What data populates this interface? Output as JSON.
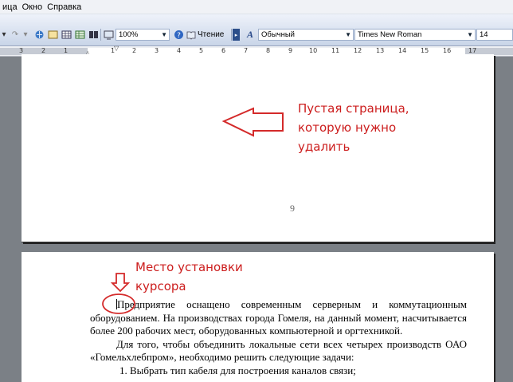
{
  "menubar": {
    "items": [
      "ица",
      "Окно",
      "Справка"
    ]
  },
  "toolbar": {
    "zoom": "100%",
    "read_mode": "Чтение",
    "style": "Обычный",
    "font": "Times New Roman",
    "font_size": "14"
  },
  "ruler": {
    "labels": [
      "3",
      "2",
      "1",
      "1",
      "2",
      "3",
      "4",
      "5",
      "6",
      "7",
      "8",
      "9",
      "10",
      "11",
      "12",
      "13",
      "14",
      "15",
      "16",
      "17"
    ]
  },
  "page1": {
    "page_number": "9"
  },
  "annotations": {
    "empty_page_line1": "Пустая страница,",
    "empty_page_line2": "которую нужно",
    "empty_page_line3": "удалить",
    "cursor_line1": "Место установки",
    "cursor_line2": "курсора"
  },
  "document": {
    "para1": "Предприятие оснащено современным серверным и коммутационным оборудованием. На производствах города Гомеля, на данный момент, насчитывается более 200 рабочих мест, оборудованных компьютерной и оргтехникой.",
    "para2": "Для того, чтобы объединить локальные сети всех четырех производств ОАО «Гомельхлебпром», необходимо решить следующие задачи:",
    "list1": "1.   Выбрать тип кабеля для построения каналов связи;"
  },
  "colors": {
    "annotation": "#cc1d1d",
    "workspace": "#7b8086"
  }
}
